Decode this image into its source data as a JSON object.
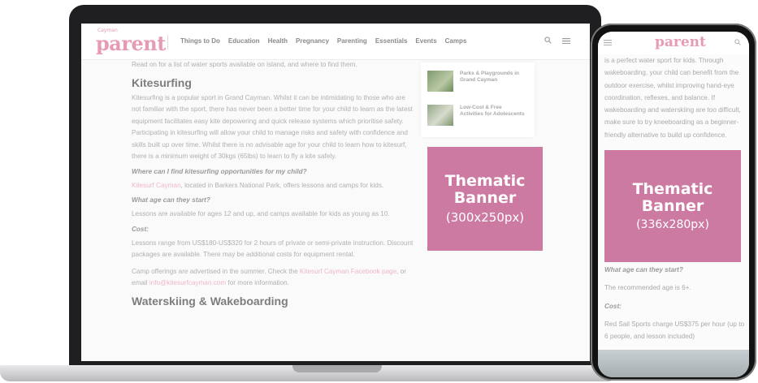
{
  "site": {
    "logo": "parent",
    "logo_sub": "Cayman",
    "nav": [
      "Things to Do",
      "Education",
      "Health",
      "Pregnancy",
      "Parenting",
      "Essentials",
      "Events",
      "Camps"
    ]
  },
  "article": {
    "intro": "Read on for a list of water sports available on island, and where to find them.",
    "heading1": "Kitesurfing",
    "para1": "Kitesurfing is a popular sport in Grand Cayman. Whilst it can be intimidating to those who are not familiar with the sport, there has never been a better time for your child to learn as the latest equipment facilitates easy kite depowering and quick release systems which prioritise safety. Participating in kitesurfing will allow your child to manage risks and safety with confidence and skills built up over time. Whilst there is no advisable age for your child to learn how to kitesurf, there is a minimum weight of 30kgs (65lbs) to learn to fly a kite safely.",
    "q1": "Where can I find kitesurfing opportunities for my child?",
    "a1_link": "Kitesurf Cayman",
    "a1_rest": ", located in Barkers National Park, offers lessons and camps for kids.",
    "q2": "What age can they start?",
    "a2": "Lessons are available for ages 12 and up, and camps available for kids as young as 10.",
    "q3": "Cost:",
    "a3": "Lessons range from US$180-US$320 for 2 hours of private or semi-private instruction. Discount packages are available. There may be additional costs for equipment rental.",
    "a4_start": "Camp offerings are advertised in the summer. Check the ",
    "a4_link1": "Kitesurf Cayman Facebook page",
    "a4_mid": ", or email ",
    "a4_link2": "info@kitesurfcayman.com",
    "a4_end": " for more information.",
    "heading2": "Waterskiing & Wakeboarding"
  },
  "sidebar": {
    "items": [
      {
        "title": "Parks & Playgrounds in Grand Cayman"
      },
      {
        "title": "Low-Cost & Free Activities for Adolescents"
      }
    ]
  },
  "banner_desktop": {
    "line1": "Thematic",
    "line2": "Banner",
    "size": "(300x250px)"
  },
  "banner_mobile": {
    "line1": "Thematic",
    "line2": "Banner",
    "size": "(336x280px)"
  },
  "mobile": {
    "logo": "parent",
    "text_top": "is a perfect water sport for kids. Through wakeboarding, your child can benefit from the outdoor exercise, whilst improving hand-eye coordination, reflexes, and balance. If wakeboarding and waterskiing are too difficult, make sure to try kneeboarding as a beginner-friendly alternative to build up confidence.",
    "q1": "What age can they start?",
    "a1": "The recommended age is 6+.",
    "q2": "Cost:",
    "a2": "Red Sail Sports charge US$375 per hour (up to 6 people, and lesson included)"
  },
  "colors": {
    "brand_pink": "#e79ab5",
    "banner": "#cc7aa2",
    "device_dark": "#1f1f21"
  }
}
